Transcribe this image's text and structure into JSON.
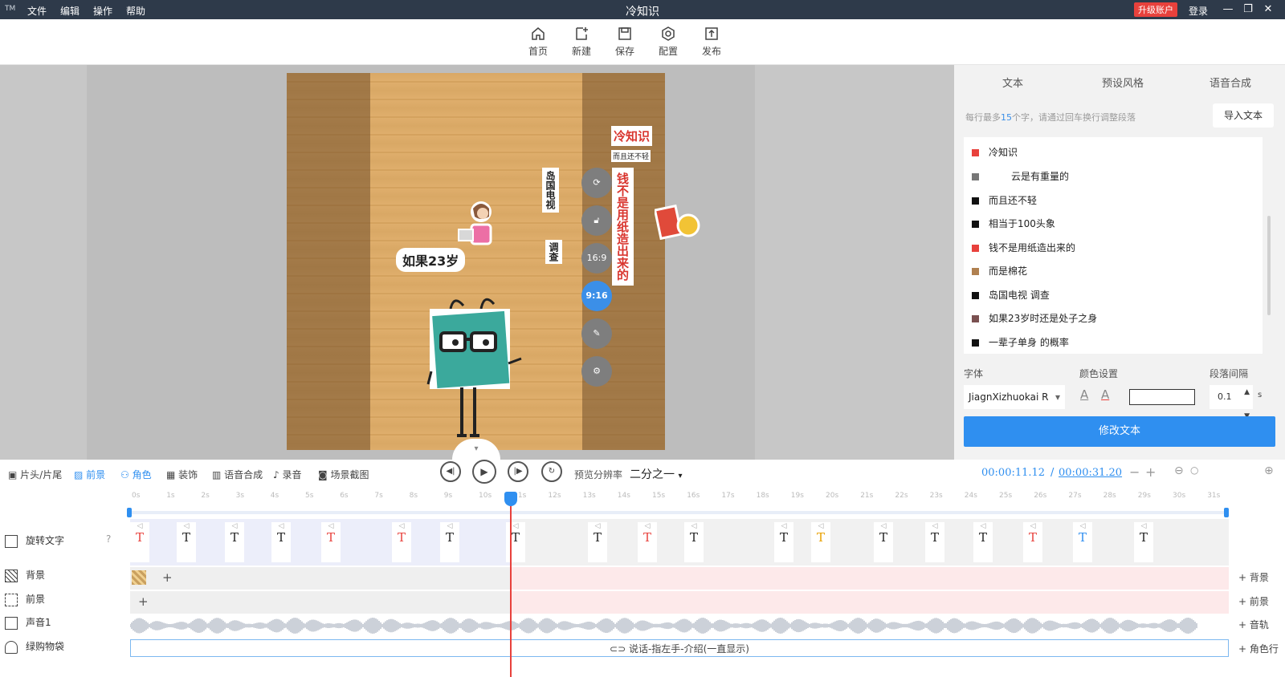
{
  "titlebar": {
    "logo": "TM",
    "menu": [
      "文件",
      "编辑",
      "操作",
      "帮助"
    ],
    "title": "冷知识",
    "upgrade": "升级账户",
    "login": "登录"
  },
  "toolbar": {
    "items": [
      {
        "label": "首页",
        "icon": "home-icon"
      },
      {
        "label": "新建",
        "icon": "new-file-icon"
      },
      {
        "label": "保存",
        "icon": "save-icon"
      },
      {
        "label": "配置",
        "icon": "settings-icon"
      },
      {
        "label": "发布",
        "icon": "publish-icon"
      }
    ]
  },
  "canvas": {
    "bubble_text": "如果23岁",
    "vertical_red": "钱不是用纸造出来的",
    "vertical_sub": "而且还不轻",
    "vertical_black1": "岛国电视",
    "vertical_black2": "调查",
    "title_sticker": "冷知识",
    "side_buttons": {
      "ratio1": "16:9",
      "ratio2": "9:16"
    }
  },
  "right_panel": {
    "tabs": [
      "文本",
      "预设风格",
      "语音合成"
    ],
    "hint_prefix": "每行最多",
    "hint_num": "15",
    "hint_suffix": "个字，请通过回车换行调整段落",
    "import_label": "导入文本",
    "rows": [
      {
        "text": "冷知识",
        "color": "#e8413c"
      },
      {
        "text": "云是有重量的",
        "color": "#777777"
      },
      {
        "text": "而且还不轻",
        "color": "#111111"
      },
      {
        "text": "相当于100头象",
        "color": "#111111"
      },
      {
        "text": "钱不是用纸造出来的",
        "color": "#e8413c"
      },
      {
        "text": "而是棉花",
        "color": "#b08050"
      },
      {
        "text": "岛国电视 调查",
        "color": "#111111"
      },
      {
        "text": "如果23岁时还是处子之身",
        "color": "#7a5050"
      },
      {
        "text": "一辈子单身 的概率",
        "color": "#111111"
      }
    ],
    "font_label": "字体",
    "color_label": "颜色设置",
    "spacing_label": "段落间隔",
    "font_value": "JiagnXizhuokai R",
    "spacing_value": "0.1",
    "spacing_unit": "s",
    "modify_label": "修改文本"
  },
  "controls": {
    "tabs": [
      {
        "label": "片头/片尾",
        "on": false
      },
      {
        "label": "前景",
        "on": true
      },
      {
        "label": "角色",
        "on": true
      },
      {
        "label": "装饰",
        "on": false
      },
      {
        "label": "语音合成",
        "on": false
      },
      {
        "label": "录音",
        "on": false
      },
      {
        "label": "场景截图",
        "on": false
      }
    ],
    "resolution_label": "预览分辨率",
    "resolution_value": "二分之一",
    "time_current": "00:00:11.12",
    "time_sep": "/",
    "time_total": "00:00:31.20"
  },
  "timeline": {
    "ticks": [
      "0s",
      "1s",
      "2s",
      "3s",
      "4s",
      "5s",
      "6s",
      "7s",
      "8s",
      "9s",
      "10s",
      "11s",
      "12s",
      "13s",
      "14s",
      "15s",
      "16s",
      "17s",
      "18s",
      "19s",
      "20s",
      "21s",
      "22s",
      "23s",
      "24s",
      "25s",
      "26s",
      "27s",
      "28s",
      "29s",
      "30s",
      "31s"
    ],
    "tracks": [
      {
        "name": "旋转文字",
        "icon": "text-icon"
      },
      {
        "name": "背景",
        "icon": "background-icon"
      },
      {
        "name": "前景",
        "icon": "foreground-icon"
      },
      {
        "name": "声音1",
        "icon": "music-icon"
      },
      {
        "name": "绿购物袋",
        "icon": "person-icon"
      }
    ],
    "clip_letter": "T",
    "clip_colors": [
      "#e8413c",
      "#222",
      "#222",
      "#222",
      "#e8413c",
      "#e8413c",
      "#222",
      "#222",
      "#222",
      "#e8413c",
      "#222",
      "#222",
      "#e8a000",
      "#222",
      "#222",
      "#222",
      "#e8413c",
      "#2f8ff0",
      "#222"
    ],
    "role_clip": "说话-指左手-介绍(一直显示)",
    "add_buttons": [
      "+ 背景",
      "+ 前景",
      "+ 音轨",
      "+ 角色行"
    ]
  }
}
